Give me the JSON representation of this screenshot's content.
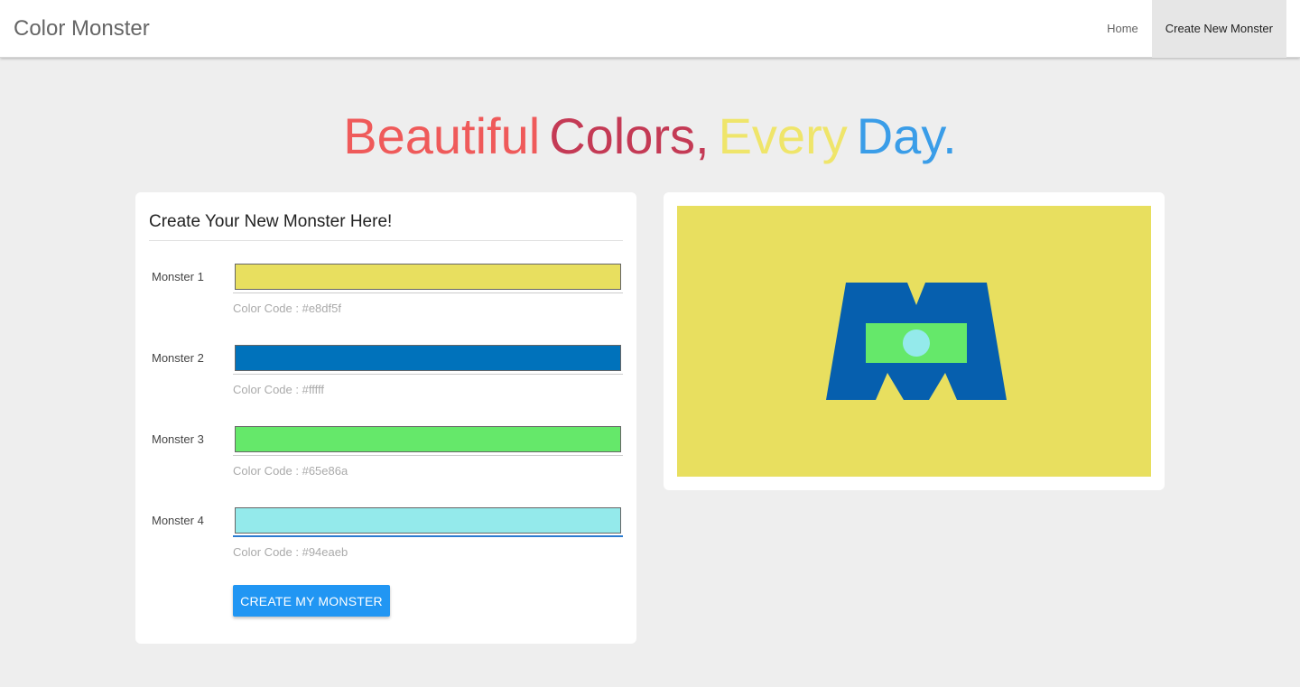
{
  "nav": {
    "brand": "Color Monster",
    "links": [
      {
        "label": "Home",
        "active": false
      },
      {
        "label": "Create New Monster",
        "active": true
      }
    ]
  },
  "hero": {
    "words": [
      {
        "text": "Beautiful",
        "color": "#ef5a5a"
      },
      {
        "text": "Colors,",
        "color": "#c43a55"
      },
      {
        "text": "Every",
        "color": "#efe56a"
      },
      {
        "text": "Day.",
        "color": "#3a9de8"
      }
    ]
  },
  "form": {
    "title": "Create Your New Monster Here!",
    "monsters": [
      {
        "label": "Monster 1",
        "color": "#e8df5f",
        "code_text": "Color Code : #e8df5f"
      },
      {
        "label": "Monster 2",
        "color": "#0072bb",
        "code_text": "Color Code : #fffff"
      },
      {
        "label": "Monster 3",
        "color": "#65e86a",
        "code_text": "Color Code : #65e86a"
      },
      {
        "label": "Monster 4",
        "color": "#94eaeb",
        "code_text": "Color Code : #94eaeb"
      }
    ],
    "button_label": "CREATE MY MONSTER"
  },
  "preview": {
    "background": "#e8df5f",
    "body_color": "#065fae",
    "band_color": "#65e86a",
    "eye_color": "#94eaeb"
  }
}
